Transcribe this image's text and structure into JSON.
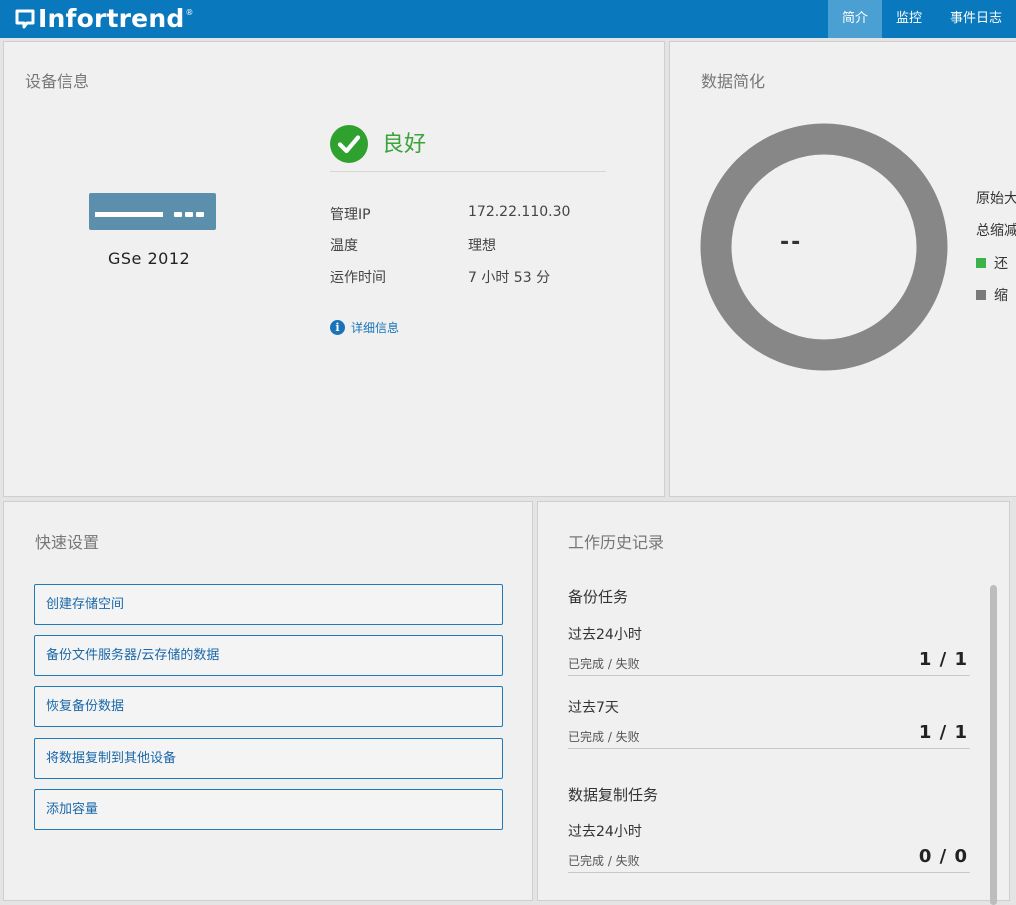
{
  "brand": {
    "name": "Infortrend",
    "registered": "®"
  },
  "nav": [
    {
      "label": "简介",
      "active": true
    },
    {
      "label": "监控",
      "active": false
    },
    {
      "label": "事件日志",
      "active": false
    }
  ],
  "device_info": {
    "title": "设备信息",
    "model": "GSe 2012",
    "status": "良好",
    "rows": [
      {
        "label": "管理IP",
        "value": "172.22.110.30"
      },
      {
        "label": "温度",
        "value": "理想"
      },
      {
        "label": "运作时间",
        "value": "7 小时 53 分"
      }
    ],
    "details_link": "详细信息"
  },
  "data_reduction": {
    "title": "数据简化",
    "center_value": "--",
    "legend_lines": [
      "原始大",
      "总缩减",
      "还",
      "缩"
    ],
    "legend_colors": [
      "#3bb34a",
      "#7a7a7a"
    ],
    "ring_color": "#878787"
  },
  "quick_setup": {
    "title": "快速设置",
    "buttons": [
      "创建存储空间",
      "备份文件服务器/云存储的数据",
      "恢复备份数据",
      "将数据复制到其他设备",
      "添加容量"
    ]
  },
  "job_history": {
    "title": "工作历史记录",
    "sections": [
      {
        "name": "备份任务",
        "periods": [
          {
            "period": "过去24小时",
            "label": "已完成 / 失败",
            "value": "1 / 1"
          },
          {
            "period": "过去7天",
            "label": "已完成 / 失败",
            "value": "1 / 1"
          }
        ]
      },
      {
        "name": "数据复制任务",
        "periods": [
          {
            "period": "过去24小时",
            "label": "已完成 / 失败",
            "value": "0 / 0"
          }
        ]
      }
    ]
  }
}
